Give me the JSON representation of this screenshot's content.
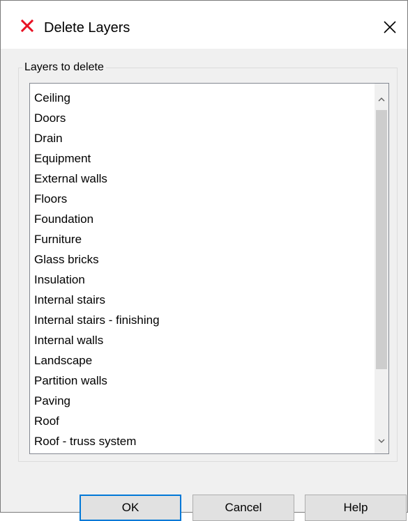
{
  "dialog": {
    "title": "Delete Layers",
    "group_label": "Layers to delete",
    "layers": [
      "Ceiling",
      "Doors",
      "Drain",
      "Equipment",
      "External walls",
      "Floors",
      "Foundation",
      "Furniture",
      "Glass bricks",
      "Insulation",
      "Internal stairs",
      "Internal stairs - finishing",
      "Internal walls",
      "Landscape",
      "Partition walls",
      "Paving",
      "Roof",
      "Roof - truss system"
    ],
    "buttons": {
      "ok": "OK",
      "cancel": "Cancel",
      "help": "Help"
    }
  },
  "colors": {
    "delete_icon": "#e81123",
    "default_button_border": "#0078d7",
    "window_background": "#f0f0f0"
  },
  "icons": {
    "title": "delete-x-icon",
    "close": "close-icon",
    "scroll_up": "chevron-up-icon",
    "scroll_down": "chevron-down-icon"
  }
}
